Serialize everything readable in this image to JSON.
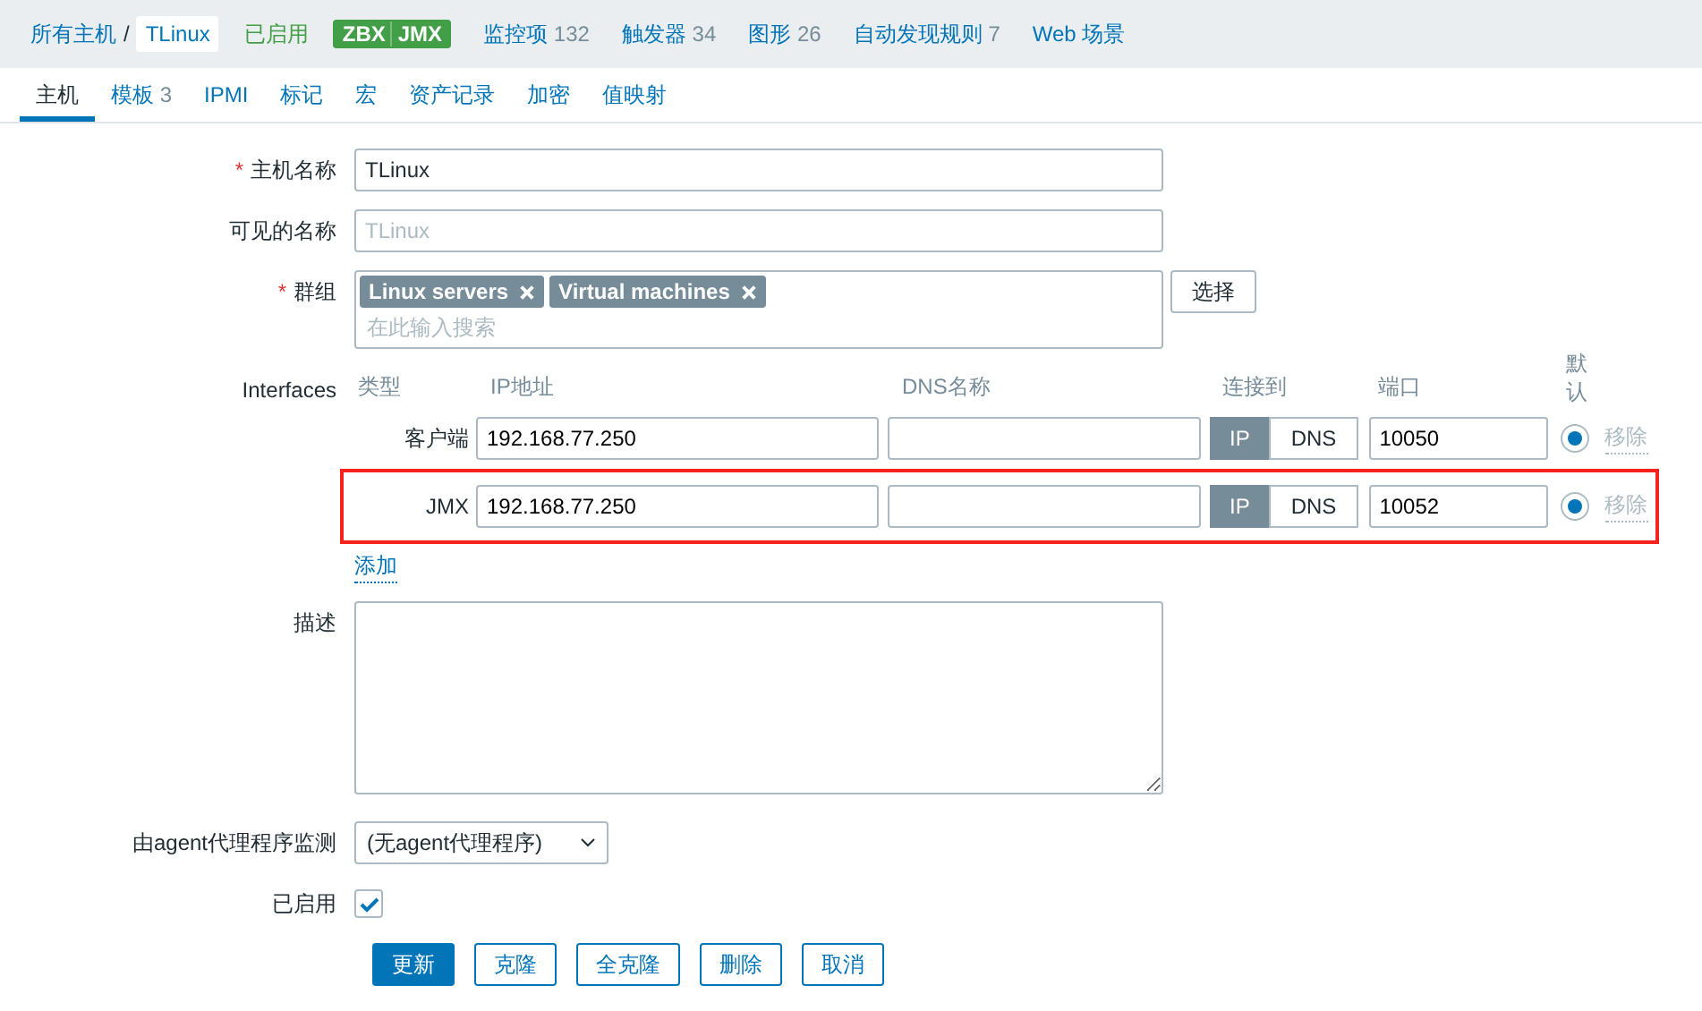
{
  "breadcrumb": [
    {
      "label": "所有主机",
      "selected": false
    },
    {
      "label": "TLinux",
      "selected": true
    }
  ],
  "separator": "/",
  "status": "已启用",
  "availability": [
    "ZBX",
    "JMX"
  ],
  "nav_links": [
    {
      "label": "监控项",
      "count": "132"
    },
    {
      "label": "触发器",
      "count": "34"
    },
    {
      "label": "图形",
      "count": "26"
    },
    {
      "label": "自动发现规则",
      "count": "7"
    },
    {
      "label": "Web 场景"
    }
  ],
  "tabs": [
    {
      "label": "主机",
      "selected": true
    },
    {
      "label": "模板",
      "count": "3",
      "selected": false
    },
    {
      "label": "IPMI",
      "selected": false
    },
    {
      "label": "标记",
      "selected": false
    },
    {
      "label": "宏",
      "selected": false
    },
    {
      "label": "资产记录",
      "selected": false
    },
    {
      "label": "加密",
      "selected": false
    },
    {
      "label": "值映射",
      "selected": false
    }
  ],
  "form": {
    "host_name": {
      "label": "主机名称",
      "marker": "*",
      "value": "TLinux"
    },
    "visible_name": {
      "label": "可见的名称",
      "placeholder": "TLinux"
    },
    "groups": {
      "label": "群组",
      "marker": "*",
      "tags": [
        "Linux servers",
        "Virtual machines"
      ],
      "placeholder": "在此输入搜索",
      "button": "选择"
    },
    "interfaces": {
      "label": "Interfaces",
      "columns": [
        "类型",
        "IP地址",
        "DNS名称",
        "连接到",
        "端口",
        "默认"
      ],
      "rows": [
        {
          "type": "客户端",
          "ip": "192.168.77.250",
          "connect": [
            {
              "label": "IP",
              "selected": true
            },
            {
              "label": "DNS",
              "selected": false
            }
          ],
          "port": "10050",
          "default": true,
          "remove": "移除",
          "disabled": true,
          "highlighted": false
        },
        {
          "type": "JMX",
          "ip": "192.168.77.250",
          "connect": [
            {
              "label": "IP",
              "selected": true
            },
            {
              "label": "DNS",
              "selected": false
            }
          ],
          "port": "10052",
          "default": true,
          "remove": "移除",
          "disabled": true,
          "highlighted": true
        }
      ],
      "add": "添加"
    },
    "description": {
      "label": "描述"
    },
    "monitored_by": {
      "label": "由agent代理程序监测",
      "value": "(无agent代理程序)"
    },
    "enabled": {
      "label": "已启用",
      "checked": true
    },
    "buttons": [
      {
        "label": "更新",
        "primary": true
      },
      {
        "label": "克隆",
        "primary": false
      },
      {
        "label": "全克隆",
        "primary": false
      },
      {
        "label": "删除",
        "primary": false
      },
      {
        "label": "取消",
        "primary": false
      }
    ]
  }
}
